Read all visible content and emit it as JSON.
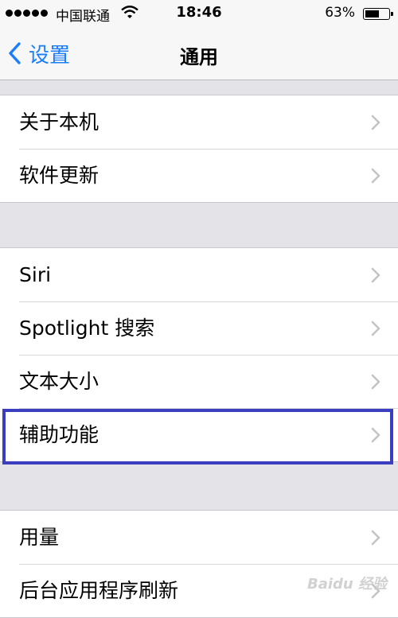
{
  "status_bar": {
    "carrier": "中国联通",
    "time": "18:46",
    "battery": "63%",
    "battery_level": 0.63,
    "signal_icon": "signal-dots-icon",
    "wifi_icon": "wifi-icon"
  },
  "nav": {
    "back_label": "设置",
    "title": "通用",
    "back_icon": "chevron-left-icon"
  },
  "groups": [
    {
      "items": [
        {
          "label": "关于本机"
        },
        {
          "label": "软件更新"
        }
      ]
    },
    {
      "items": [
        {
          "label": "Siri"
        },
        {
          "label": "Spotlight 搜索"
        },
        {
          "label": "文本大小"
        },
        {
          "label": "辅助功能",
          "highlighted": true
        }
      ]
    },
    {
      "items": [
        {
          "label": "用量"
        },
        {
          "label": "后台应用程序刷新"
        }
      ]
    }
  ],
  "colors": {
    "accent": "#1a7efb",
    "highlight_border": "#3b3fbf",
    "background": "#e4e4e8"
  },
  "watermark": "Baidu 经验"
}
